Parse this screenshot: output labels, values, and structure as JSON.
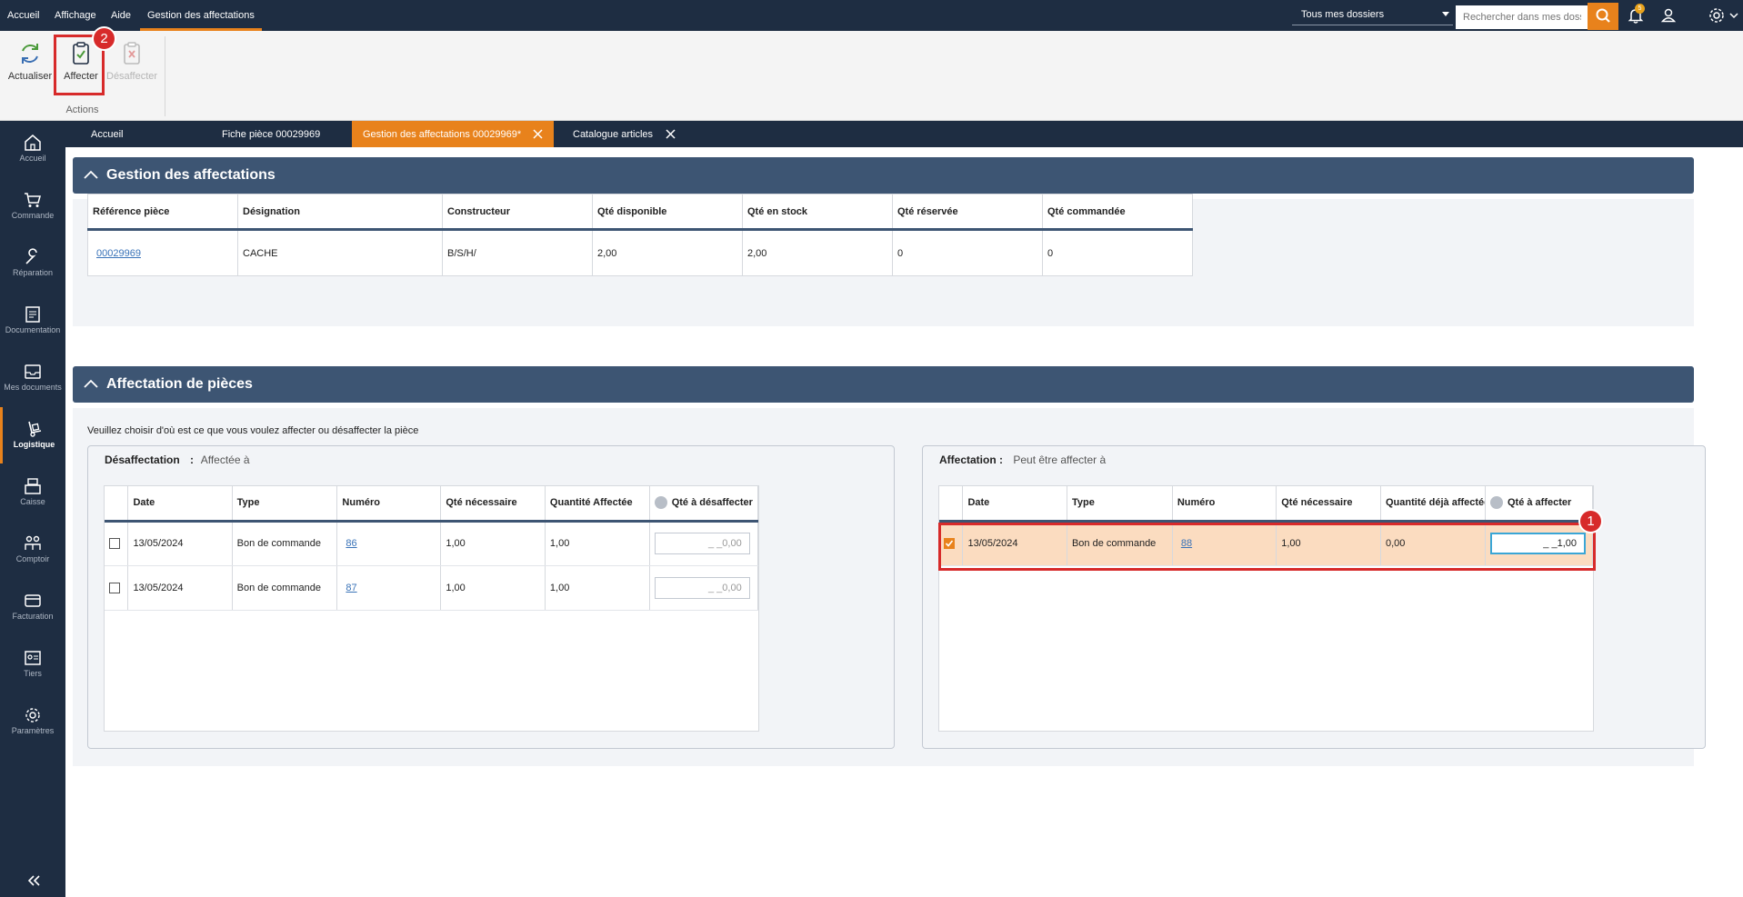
{
  "menu": {
    "items": [
      "Accueil",
      "Affichage",
      "Aide",
      "Gestion des affectations"
    ],
    "dossier_select": "Tous mes dossiers",
    "search_placeholder": "Rechercher dans mes dossiers",
    "notification_count": "5"
  },
  "ribbon": {
    "actualiser": "Actualiser",
    "affecter": "Affecter",
    "desaffecter": "Désaffecter",
    "group_label": "Actions",
    "badge_affecter": "2"
  },
  "sidebar": {
    "items": [
      "Accueil",
      "Commande",
      "Réparation",
      "Documentation",
      "Mes documents",
      "Logistique",
      "Caisse",
      "Comptoir",
      "Facturation",
      "Tiers",
      "Paramètres"
    ]
  },
  "tabs": [
    {
      "label": "Accueil"
    },
    {
      "label": "Fiche pièce 00029969"
    },
    {
      "label": "Gestion des affectations 00029969*"
    },
    {
      "label": "Catalogue articles"
    }
  ],
  "section1": {
    "title": "Gestion des affectations",
    "columns": [
      "Référence pièce",
      "Désignation",
      "Constructeur",
      "Qté disponible",
      "Qté en stock",
      "Qté réservée",
      "Qté commandée"
    ],
    "row": [
      "00029969",
      "CACHE",
      "B/S/H/",
      "2,00",
      "2,00",
      "0",
      "0"
    ]
  },
  "section2": {
    "title": "Affectation de pièces",
    "intro": "Veuillez choisir d'où est ce que vous voulez affecter ou désaffecter la pièce",
    "left": {
      "title": "Désaffectation",
      "colon": ":",
      "subtitle": "Affectée à",
      "columns": [
        "Date",
        "Type",
        "Numéro",
        "Qté nécessaire",
        "Quantité Affectée",
        "Qté à désaffecter"
      ],
      "rows": [
        {
          "date": "13/05/2024",
          "type": "Bon de commande",
          "numero": "86",
          "qte_necessaire": "1,00",
          "qte_affectee": "1,00",
          "qte_input": "_ _0,00"
        },
        {
          "date": "13/05/2024",
          "type": "Bon de commande",
          "numero": "87",
          "qte_necessaire": "1,00",
          "qte_affectee": "1,00",
          "qte_input": "_ _0,00"
        }
      ]
    },
    "right": {
      "title": "Affectation :",
      "subtitle": "Peut être affecter à",
      "columns": [
        "Date",
        "Type",
        "Numéro",
        "Qté nécessaire",
        "Quantité déjà affectée",
        "Qté à affecter"
      ],
      "rows": [
        {
          "date": "13/05/2024",
          "type": "Bon de commande",
          "numero": "88",
          "qte_necessaire": "1,00",
          "qte_deja": "0,00",
          "qte_input": "_ _1,00"
        }
      ],
      "badge": "1"
    }
  },
  "colors": {
    "navy": "#1e2d42",
    "accent": "#e8821c",
    "section": "#3d5573",
    "highlight": "#d72a2a"
  }
}
